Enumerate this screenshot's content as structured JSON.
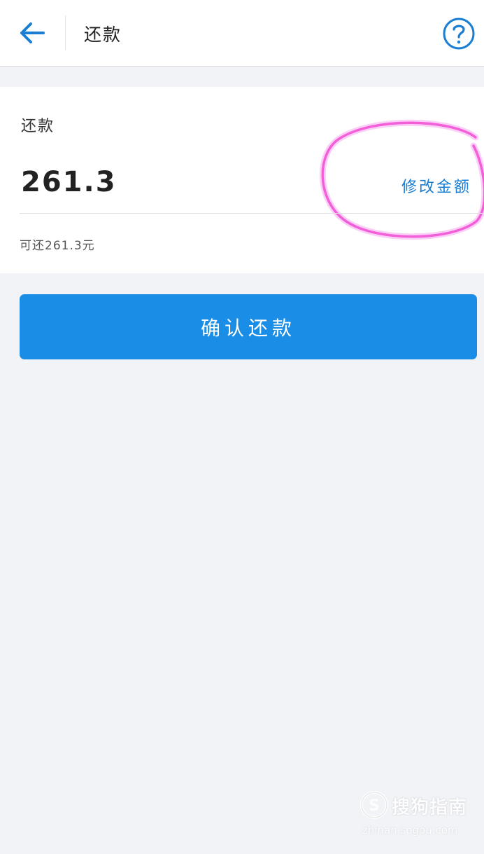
{
  "header": {
    "title": "还款",
    "back_icon": "arrow-left-icon",
    "help_icon": "question-circle-icon"
  },
  "repay_card": {
    "label": "还款",
    "amount": "261.3",
    "modify_label": "修改金额",
    "available_text": "可还261.3元"
  },
  "confirm_button": {
    "label": "确认还款"
  },
  "watermark": {
    "brand": "搜狗指南",
    "url": "zhinan.sogou.com"
  },
  "colors": {
    "accent": "#1a8ee6",
    "link": "#1a7fd4",
    "annotation": "#f25fd9",
    "background": "#f1f3f7"
  }
}
